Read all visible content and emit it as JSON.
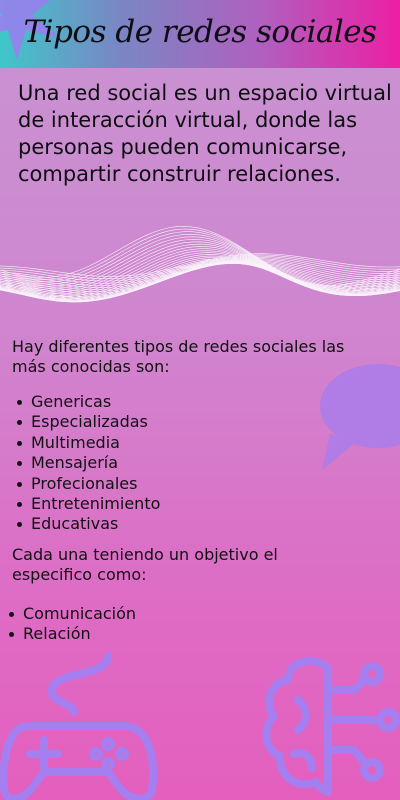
{
  "header": {
    "title": "Tipos de redes sociales"
  },
  "intro": "Una red social es un espacio virtual de interacción virtual, donde las personas pueden comunicarse, compartir construir relaciones.",
  "lead": "Hay diferentes tipos de redes sociales las más conocidas son:",
  "types": [
    "Genericas",
    "Especializadas",
    "Multimedia",
    "Mensajería",
    "Profecionales",
    "Entretenimiento",
    "Educativas"
  ],
  "objective": "Cada una teniendo un objetivo el especifico como:",
  "goals": [
    "Comunicación",
    "Relación"
  ],
  "decorations": {
    "star": "star-icon",
    "wave": "wave-lines",
    "bubble": "speech-bubble-icon",
    "gamepad": "gamepad-icon",
    "brain": "brain-circuit-icon"
  },
  "colors": {
    "header_start": "#3fc7c9",
    "header_end": "#ec1fa3",
    "background_top": "#c894d2",
    "background_bottom": "#e45fbe",
    "accent_purple": "#b07ce6"
  }
}
